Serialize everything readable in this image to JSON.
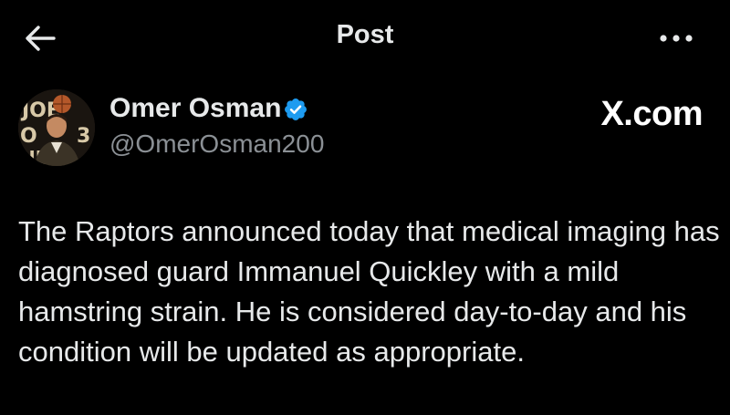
{
  "header": {
    "title": "Post",
    "back_icon": "back-arrow-icon",
    "more_icon": "more-horizontal-icon"
  },
  "author": {
    "name": "Omer Osman",
    "handle": "@OmerOsman200",
    "verified": true,
    "verified_color": "#1d9bf0"
  },
  "watermark": "X.com",
  "post": {
    "text": "The Raptors announced today that medical imaging has diagnosed guard Immanuel Quickley with a mild hamstring strain. He is considered day-to-day and his condition will be updated as appropriate."
  }
}
